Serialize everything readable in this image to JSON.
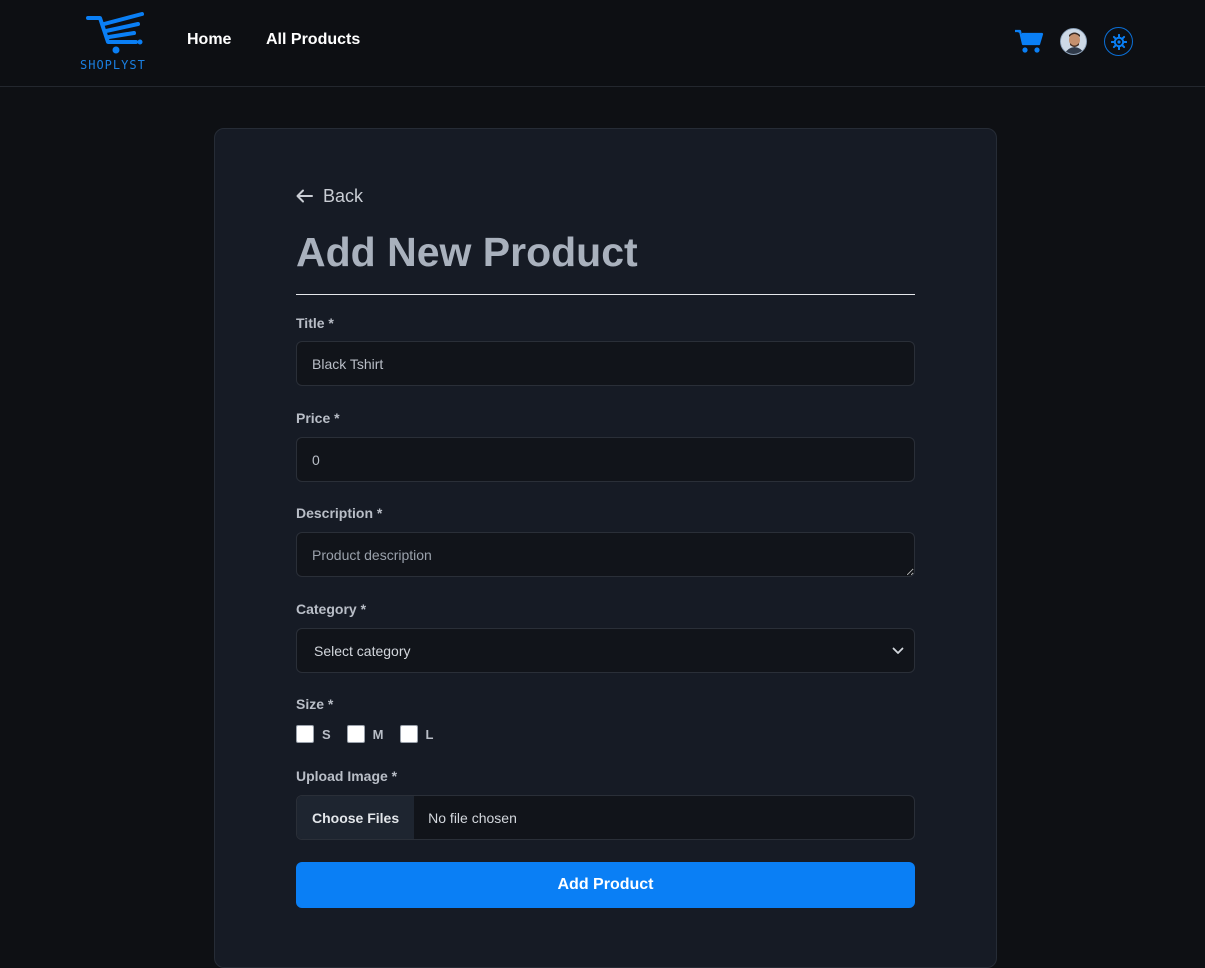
{
  "header": {
    "brand": "SHOPLYST",
    "nav": {
      "home": "Home",
      "all_products": "All Products"
    },
    "icons": [
      "cart-icon",
      "avatar",
      "settings-icon"
    ],
    "accent_color": "#0a7ff5"
  },
  "form": {
    "back_label": "Back",
    "title": "Add New Product",
    "fields": {
      "title": {
        "label": "Title *",
        "value": "Black Tshirt",
        "placeholder": ""
      },
      "price": {
        "label": "Price *",
        "value": "0"
      },
      "description": {
        "label": "Description *",
        "placeholder": "Product description"
      },
      "category": {
        "label": "Category *",
        "selected": "Select category"
      },
      "size": {
        "label": "Size *",
        "options": [
          "S",
          "M",
          "L"
        ]
      },
      "image": {
        "label": "Upload Image *",
        "button": "Choose Files",
        "status": "No file chosen"
      }
    },
    "submit_label": "Add Product"
  }
}
